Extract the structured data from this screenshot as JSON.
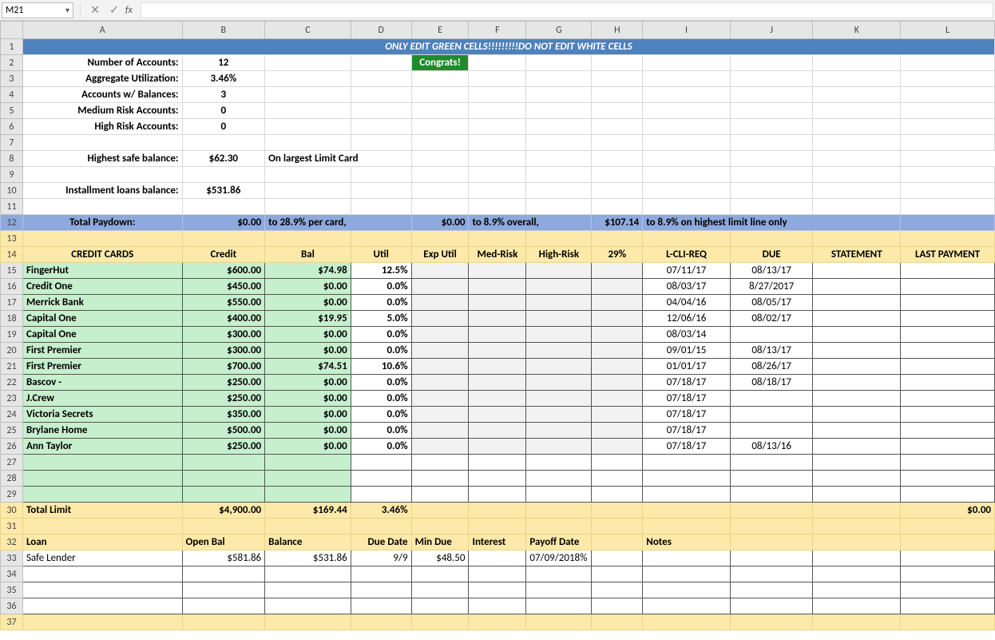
{
  "name_box": "M21",
  "formula": "",
  "banner": "ONLY EDIT GREEN CELLS!!!!!!!!!DO NOT EDIT WHITE CELLS",
  "congrats": "Congrats!",
  "summary_labels": {
    "num_accounts": "Number of Accounts:",
    "aggregate_util": "Aggregate Utilization:",
    "accounts_w_bal": "Accounts w/ Balances:",
    "med_risk": "Medium Risk Accounts:",
    "high_risk": "High Risk Accounts:",
    "highest_safe_bal": "Highest safe balance:",
    "on_largest": "On largest Limit Card",
    "install_bal": "Installment loans balance:"
  },
  "summary_values": {
    "num_accounts": "12",
    "aggregate_util": "3.46%",
    "accounts_w_bal": "3",
    "med_risk": "0",
    "high_risk": "0",
    "highest_safe_bal": "$62.30",
    "install_bal": "$531.86"
  },
  "paydown": {
    "label": "Total Paydown:",
    "val1": "$0.00",
    "txt1": "to 28.9% per card,",
    "val2": "$0.00",
    "txt2": "to 8.9% overall,",
    "val3": "$107.14",
    "txt3": "to 8.9% on highest limit line only"
  },
  "cc_headers": {
    "credit_cards": "CREDIT CARDS",
    "credit": "Credit",
    "bal": "Bal",
    "util": "Util",
    "exp_util": "Exp Util",
    "med_risk": "Med-Risk",
    "high_risk": "High-Risk",
    "p29": "29%",
    "lcli": "L-CLI-REQ",
    "due": "DUE",
    "statement": "STATEMENT",
    "last_payment": "LAST PAYMENT"
  },
  "cards": [
    {
      "name": "FingerHut",
      "credit": "$600.00",
      "bal": "$74.98",
      "util": "12.5%",
      "lcli": "07/11/17",
      "due": "08/13/17"
    },
    {
      "name": "Credit One",
      "credit": "$450.00",
      "bal": "$0.00",
      "util": "0.0%",
      "lcli": "08/03/17",
      "due": "8/27/2017"
    },
    {
      "name": "Merrick Bank",
      "credit": "$550.00",
      "bal": "$0.00",
      "util": "0.0%",
      "lcli": "04/04/16",
      "due": "08/05/17"
    },
    {
      "name": "Capital One",
      "credit": "$400.00",
      "bal": "$19.95",
      "util": "5.0%",
      "lcli": "12/06/16",
      "due": "08/02/17"
    },
    {
      "name": "Capital One",
      "credit": "$300.00",
      "bal": "$0.00",
      "util": "0.0%",
      "lcli": "08/03/14",
      "due": ""
    },
    {
      "name": "First Premier",
      "credit": "$300.00",
      "bal": "$0.00",
      "util": "0.0%",
      "lcli": "09/01/15",
      "due": "08/13/17"
    },
    {
      "name": "First Premier",
      "credit": "$700.00",
      "bal": "$74.51",
      "util": "10.6%",
      "lcli": "01/01/17",
      "due": "08/26/17"
    },
    {
      "name": "Bascov - ",
      "credit": "$250.00",
      "bal": "$0.00",
      "util": "0.0%",
      "lcli": "07/18/17",
      "due": "08/18/17"
    },
    {
      "name": "J.Crew",
      "credit": "$250.00",
      "bal": "$0.00",
      "util": "0.0%",
      "lcli": "07/18/17",
      "due": ""
    },
    {
      "name": "Victoria Secrets",
      "credit": "$350.00",
      "bal": "$0.00",
      "util": "0.0%",
      "lcli": "07/18/17",
      "due": ""
    },
    {
      "name": "Brylane Home",
      "credit": "$500.00",
      "bal": "$0.00",
      "util": "0.0%",
      "lcli": "07/18/17",
      "due": ""
    },
    {
      "name": "Ann Taylor",
      "credit": "$250.00",
      "bal": "$0.00",
      "util": "0.0%",
      "lcli": "07/18/17",
      "due": "08/13/16"
    }
  ],
  "totals": {
    "label": "Total Limit",
    "credit": "$4,900.00",
    "bal": "$169.44",
    "util": "3.46%",
    "last_col": "$0.00"
  },
  "loan_headers": {
    "loan": "Loan",
    "open_bal": "Open Bal",
    "balance": "Balance",
    "due_date": "Due Date",
    "min_due": "Min Due",
    "interest": "Interest",
    "payoff_date": "Payoff Date",
    "notes": "Notes"
  },
  "loan": {
    "name": "Safe Lender",
    "open_bal": "$581.86",
    "balance": "$531.86",
    "due_date": "9/9",
    "min_due": "$48.50",
    "interest": "",
    "payoff_date": "07/09/2018%"
  },
  "col_letters": [
    "A",
    "B",
    "C",
    "D",
    "E",
    "F",
    "G",
    "H",
    "I",
    "J",
    "K",
    "L"
  ]
}
